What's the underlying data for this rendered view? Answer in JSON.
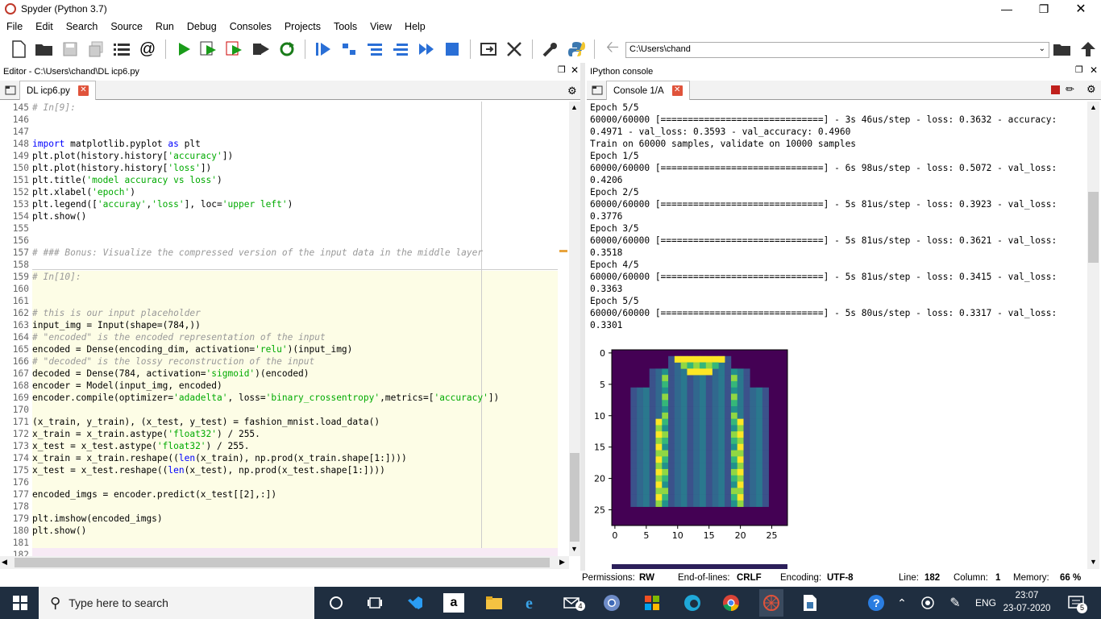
{
  "window": {
    "title": "Spyder (Python 3.7)"
  },
  "menu": [
    "File",
    "Edit",
    "Search",
    "Source",
    "Run",
    "Debug",
    "Consoles",
    "Projects",
    "Tools",
    "View",
    "Help"
  ],
  "toolbar": {
    "path": "C:\\Users\\chand"
  },
  "editor": {
    "header": "Editor - C:\\Users\\chand\\DL icp6.py",
    "tab": "DL icp6.py",
    "lines": [
      {
        "n": "145",
        "t": "# In[9]:",
        "c": "cm"
      },
      {
        "n": "146",
        "t": ""
      },
      {
        "n": "147",
        "t": ""
      },
      {
        "n": "148",
        "t": "import matplotlib.pyplot as plt"
      },
      {
        "n": "149",
        "t": "plt.plot(history.history['accuracy'])"
      },
      {
        "n": "150",
        "t": "plt.plot(history.history['loss'])"
      },
      {
        "n": "151",
        "t": "plt.title('model accuracy vs loss')"
      },
      {
        "n": "152",
        "t": "plt.xlabel('epoch')"
      },
      {
        "n": "153",
        "t": "plt.legend(['accuray','loss'], loc='upper left')"
      },
      {
        "n": "154",
        "t": "plt.show()"
      },
      {
        "n": "155",
        "t": ""
      },
      {
        "n": "156",
        "t": ""
      },
      {
        "n": "157",
        "t": "# ### Bonus: Visualize the compressed version of the input data in the middle layer",
        "c": "cm"
      },
      {
        "n": "158",
        "t": ""
      },
      {
        "n": "159",
        "t": "# In[10]:",
        "c": "cm"
      },
      {
        "n": "160",
        "t": ""
      },
      {
        "n": "161",
        "t": ""
      },
      {
        "n": "162",
        "t": "# this is our input placeholder",
        "c": "cm"
      },
      {
        "n": "163",
        "t": "input_img = Input(shape=(784,))"
      },
      {
        "n": "164",
        "t": "# \"encoded\" is the encoded representation of the input",
        "c": "cm"
      },
      {
        "n": "165",
        "t": "encoded = Dense(encoding_dim, activation='relu')(input_img)"
      },
      {
        "n": "166",
        "t": "# \"decoded\" is the lossy reconstruction of the input",
        "c": "cm"
      },
      {
        "n": "167",
        "t": "decoded = Dense(784, activation='sigmoid')(encoded)"
      },
      {
        "n": "168",
        "t": "encoder = Model(input_img, encoded)"
      },
      {
        "n": "169",
        "t": "encoder.compile(optimizer='adadelta', loss='binary_crossentropy',metrics=['accuracy'])"
      },
      {
        "n": "170",
        "t": ""
      },
      {
        "n": "171",
        "t": "(x_train, y_train), (x_test, y_test) = fashion_mnist.load_data()"
      },
      {
        "n": "172",
        "t": "x_train = x_train.astype('float32') / 255."
      },
      {
        "n": "173",
        "t": "x_test = x_test.astype('float32') / 255."
      },
      {
        "n": "174",
        "t": "x_train = x_train.reshape((len(x_train), np.prod(x_train.shape[1:])))"
      },
      {
        "n": "175",
        "t": "x_test = x_test.reshape((len(x_test), np.prod(x_test.shape[1:])))"
      },
      {
        "n": "176",
        "t": ""
      },
      {
        "n": "177",
        "t": "encoded_imgs = encoder.predict(x_test[[2],:])"
      },
      {
        "n": "178",
        "t": ""
      },
      {
        "n": "179",
        "t": "plt.imshow(encoded_imgs)"
      },
      {
        "n": "180",
        "t": "plt.show()"
      },
      {
        "n": "181",
        "t": ""
      },
      {
        "n": "182",
        "t": ""
      }
    ]
  },
  "console": {
    "header": "IPython console",
    "tab": "Console 1/A",
    "lines": [
      "Epoch 5/5",
      "60000/60000 [==============================] - 3s 46us/step - loss: 0.3632 - accuracy:",
      "0.4971 - val_loss: 0.3593 - val_accuracy: 0.4960",
      "Train on 60000 samples, validate on 10000 samples",
      "Epoch 1/5",
      "60000/60000 [==============================] - 6s 98us/step - loss: 0.5072 - val_loss:",
      "0.4206",
      "Epoch 2/5",
      "60000/60000 [==============================] - 5s 81us/step - loss: 0.3923 - val_loss:",
      "0.3776",
      "Epoch 3/5",
      "60000/60000 [==============================] - 5s 81us/step - loss: 0.3621 - val_loss:",
      "0.3518",
      "Epoch 4/5",
      "60000/60000 [==============================] - 5s 81us/step - loss: 0.3415 - val_loss:",
      "0.3363",
      "Epoch 5/5",
      "60000/60000 [==============================] - 5s 80us/step - loss: 0.3317 - val_loss:",
      "0.3301"
    ],
    "plot": {
      "yticks": [
        "0",
        "5",
        "10",
        "15",
        "20",
        "25"
      ],
      "xticks": [
        "0",
        "5",
        "10",
        "15",
        "20",
        "25"
      ]
    }
  },
  "status": {
    "permissions_label": "Permissions:",
    "permissions": "RW",
    "eol_label": "End-of-lines:",
    "eol": "CRLF",
    "encoding_label": "Encoding:",
    "encoding": "UTF-8",
    "line_label": "Line:",
    "line": "182",
    "column_label": "Column:",
    "column": "1",
    "memory_label": "Memory:",
    "memory": "66 %"
  },
  "taskbar": {
    "search_placeholder": "Type here to search",
    "lang": "ENG",
    "time": "23:07",
    "date": "23-07-2020",
    "notif_count": "5",
    "mail_count": "4"
  }
}
